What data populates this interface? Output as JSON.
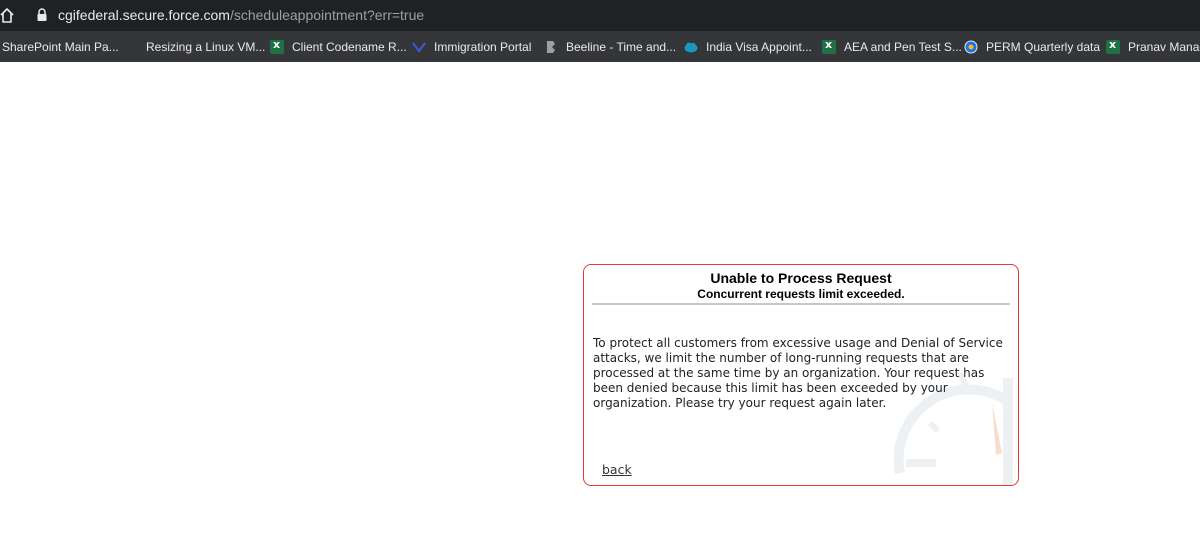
{
  "browser": {
    "url_host": "cgifederal.secure.force.com",
    "url_path": "/scheduleappointment?err=true"
  },
  "bookmarks": [
    {
      "label": "SharePoint Main Pa...",
      "icon": "blank"
    },
    {
      "label": "Resizing a Linux VM...",
      "icon": "blank"
    },
    {
      "label": "Client Codename R...",
      "icon": "excel-icon"
    },
    {
      "label": "Immigration Portal",
      "icon": "portal-icon"
    },
    {
      "label": "Beeline - Time and...",
      "icon": "beeline-icon"
    },
    {
      "label": "India Visa Appoint...",
      "icon": "salesforce-cloud-icon"
    },
    {
      "label": "AEA and Pen Test S...",
      "icon": "excel-icon"
    },
    {
      "label": "PERM Quarterly data",
      "icon": "globe-icon"
    },
    {
      "label": "Pranav Manag",
      "icon": "excel-icon"
    }
  ],
  "error": {
    "title": "Unable to Process Request",
    "subtitle": "Concurrent requests limit exceeded.",
    "message": "To protect all customers from excessive usage and Denial of Service attacks, we limit the number of long-running requests that are processed at the same time by an organization. Your request has been denied because this limit has been exceeded by your organization. Please try your request again later.",
    "back_label": "back"
  },
  "colors": {
    "error_border": "#e03c3c",
    "toolbar_bg": "#35363a",
    "address_bg": "#202124"
  }
}
